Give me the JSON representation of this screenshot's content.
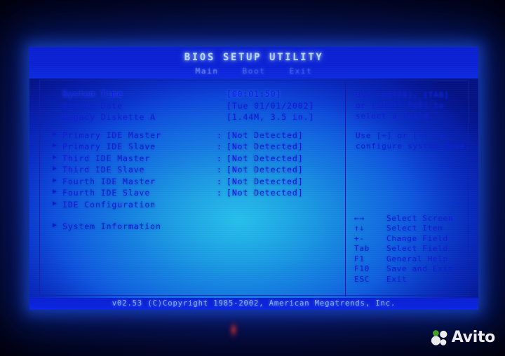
{
  "screen": {
    "title": "BIOS SETUP UTILITY",
    "menu_tabs": [
      {
        "label": "Main",
        "active": true
      },
      {
        "label": "Boot",
        "active": false
      },
      {
        "label": "Exit",
        "active": false
      }
    ],
    "options": [
      {
        "arrow": "",
        "label": "System Time",
        "colon": "",
        "value": "[00:01:50]",
        "selected": true
      },
      {
        "arrow": "",
        "label": "System Date",
        "colon": "",
        "value": "[Tue 01/01/2002]",
        "selected": false
      },
      {
        "arrow": "",
        "label": "Legacy Diskette A",
        "colon": "",
        "value": "[1.44M, 3.5 in.]",
        "selected": false
      },
      {
        "arrow": "▶",
        "label": "Primary IDE Master",
        "colon": ":",
        "value": "[Not Detected]",
        "selected": false
      },
      {
        "arrow": "▶",
        "label": "Primary IDE Slave",
        "colon": ":",
        "value": "[Not Detected]",
        "selected": false
      },
      {
        "arrow": "▶",
        "label": "Third IDE Master",
        "colon": ":",
        "value": "[Not Detected]",
        "selected": false
      },
      {
        "arrow": "▶",
        "label": "Third IDE Slave",
        "colon": ":",
        "value": "[Not Detected]",
        "selected": false
      },
      {
        "arrow": "▶",
        "label": "Fourth IDE Master",
        "colon": ":",
        "value": "[Not Detected]",
        "selected": false
      },
      {
        "arrow": "▶",
        "label": "Fourth IDE Slave",
        "colon": ":",
        "value": "[Not Detected]",
        "selected": false
      },
      {
        "arrow": "▶",
        "label": "IDE Configuration",
        "colon": "",
        "value": "",
        "selected": false
      },
      {
        "arrow": "▶",
        "label": "System Information",
        "colon": "",
        "value": "",
        "selected": false
      }
    ],
    "help": {
      "paragraph1": [
        "Use [ENTER], [TAB]",
        "or [SHIFT-TAB] to",
        "select a field."
      ],
      "paragraph2": [
        "Use [+] or [-] to",
        "configure system Time."
      ]
    },
    "legend": [
      {
        "key": "←→",
        "desc": "Select Screen"
      },
      {
        "key": "↑↓",
        "desc": "Select Item"
      },
      {
        "key": "+-",
        "desc": "Change Field"
      },
      {
        "key": "Tab",
        "desc": "Select Field"
      },
      {
        "key": "F1",
        "desc": "General Help"
      },
      {
        "key": "F10",
        "desc": "Save and Exit"
      },
      {
        "key": "ESC",
        "desc": "Exit"
      }
    ],
    "footer": "v02.53 (C)Copyright 1985-2002, American Megatrends, Inc."
  },
  "watermark": {
    "text": "Avito",
    "dot_color": "#4caf26",
    "circle_color": "#ffffff"
  },
  "colors": {
    "screen_glow": "#1490e0",
    "bar_blue": "#0a1fd4",
    "text_blue": "#0c1ccd",
    "title_text": "#bcd8ff"
  }
}
